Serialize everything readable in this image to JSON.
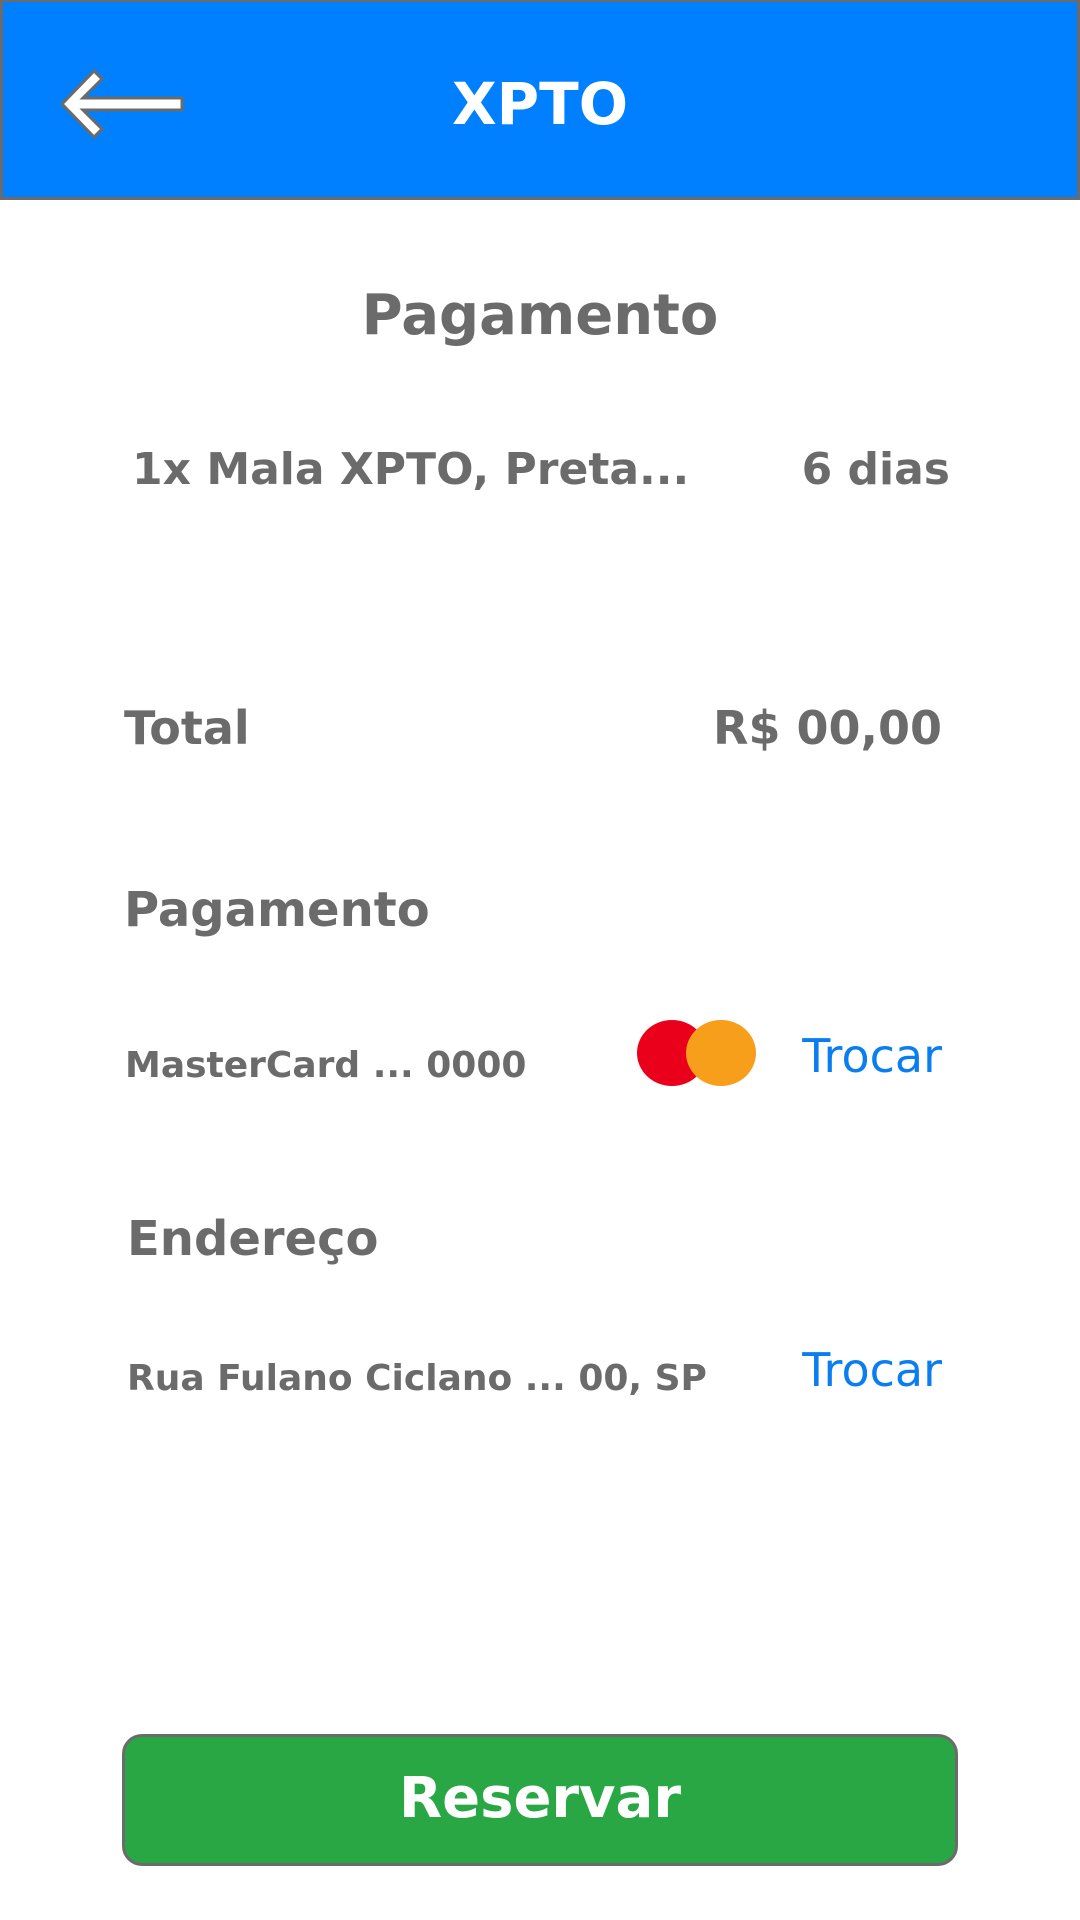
{
  "header": {
    "title": "XPTO",
    "back_icon": "arrow-left-icon",
    "background_color": "#0080FF",
    "title_color": "#FFFFFF"
  },
  "page": {
    "title": "Pagamento",
    "text_color": "#6B6B6B"
  },
  "order": {
    "item_name": "1x Mala XPTO, Preta...",
    "duration": "6 dias"
  },
  "total": {
    "label": "Total",
    "value": "R$ 00,00"
  },
  "payment": {
    "section_title": "Pagamento",
    "card_label": "MasterCard ... 0000",
    "card_icon": "mastercard-logo-icon",
    "card_icon_colors": [
      "#EB001B",
      "#F79E1B"
    ],
    "change_label": "Trocar"
  },
  "address": {
    "section_title": "Endereço",
    "value": "Rua Fulano Ciclano ... 00, SP",
    "change_label": "Trocar"
  },
  "link_color": "#0A7EF0",
  "reserve_button": {
    "label": "Reservar",
    "background_color": "#29A745",
    "text_color": "#FFFFFF"
  }
}
